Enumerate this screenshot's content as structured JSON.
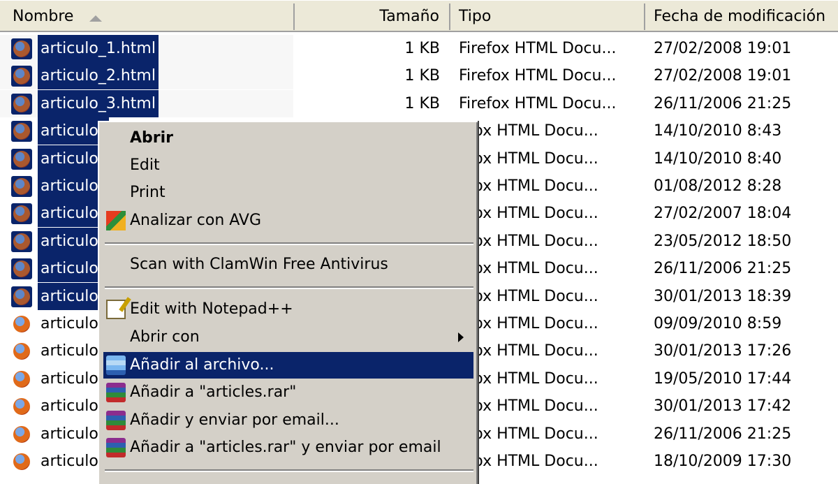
{
  "columns": {
    "name": "Nombre",
    "size": "Tamaño",
    "type": "Tipo",
    "date": "Fecha de modificación"
  },
  "files": [
    {
      "name": "articulo_1.html",
      "size": "1 KB",
      "type": "Firefox HTML Docu...",
      "date": "27/02/2008 19:01",
      "selected": true
    },
    {
      "name": "articulo_2.html",
      "size": "1 KB",
      "type": "Firefox HTML Docu...",
      "date": "27/02/2008 19:01",
      "selected": true
    },
    {
      "name": "articulo_3.html",
      "size": "1 KB",
      "type": "Firefox HTML Docu...",
      "date": "26/11/2006 21:25",
      "selected": true
    },
    {
      "name": "articulo_",
      "size": "",
      "type": "efox HTML Docu...",
      "date": "14/10/2010 8:43",
      "selected": true
    },
    {
      "name": "articulo_",
      "size": "",
      "type": "efox HTML Docu...",
      "date": "14/10/2010 8:40",
      "selected": true
    },
    {
      "name": "articulo_",
      "size": "",
      "type": "efox HTML Docu...",
      "date": "01/08/2012 8:28",
      "selected": true
    },
    {
      "name": "articulo_",
      "size": "",
      "type": "efox HTML Docu...",
      "date": "27/02/2007 18:04",
      "selected": true
    },
    {
      "name": "articulo_",
      "size": "",
      "type": "efox HTML Docu...",
      "date": "23/05/2012 18:50",
      "selected": true
    },
    {
      "name": "articulo_",
      "size": "",
      "type": "efox HTML Docu...",
      "date": "26/11/2006 21:25",
      "selected": true
    },
    {
      "name": "articulo_",
      "size": "",
      "type": "efox HTML Docu...",
      "date": "30/01/2013 18:39",
      "selected": true
    },
    {
      "name": "articulo_",
      "size": "",
      "type": "efox HTML Docu...",
      "date": "09/09/2010 8:59",
      "selected": false
    },
    {
      "name": "articulo_",
      "size": "",
      "type": "efox HTML Docu...",
      "date": "30/01/2013 17:26",
      "selected": false
    },
    {
      "name": "articulo_",
      "size": "",
      "type": "efox HTML Docu...",
      "date": "19/05/2010 17:44",
      "selected": false
    },
    {
      "name": "articulo_",
      "size": "",
      "type": "efox HTML Docu...",
      "date": "30/01/2013 17:42",
      "selected": false
    },
    {
      "name": "articulo_",
      "size": "",
      "type": "efox HTML Docu...",
      "date": "26/11/2006 21:25",
      "selected": false
    },
    {
      "name": "articulo_",
      "size": "",
      "type": "efox HTML Docu...",
      "date": "18/10/2009 17:30",
      "selected": false
    }
  ],
  "context_menu": {
    "open": "Abrir",
    "edit": "Edit",
    "print": "Print",
    "avg": "Analizar con AVG",
    "clamwin": "Scan with ClamWin Free Antivirus",
    "notepadpp": "Edit with Notepad++",
    "open_with": "Abrir con",
    "add_archive": "Añadir al archivo...",
    "add_rar": "Añadir a \"articles.rar\"",
    "add_email": "Añadir y enviar por email...",
    "add_rar_email": "Añadir a \"articles.rar\" y enviar por email"
  },
  "colors": {
    "selection": "#0a246a",
    "menu_bg": "#d4d0c8",
    "header_bg": "#ece9d8"
  }
}
